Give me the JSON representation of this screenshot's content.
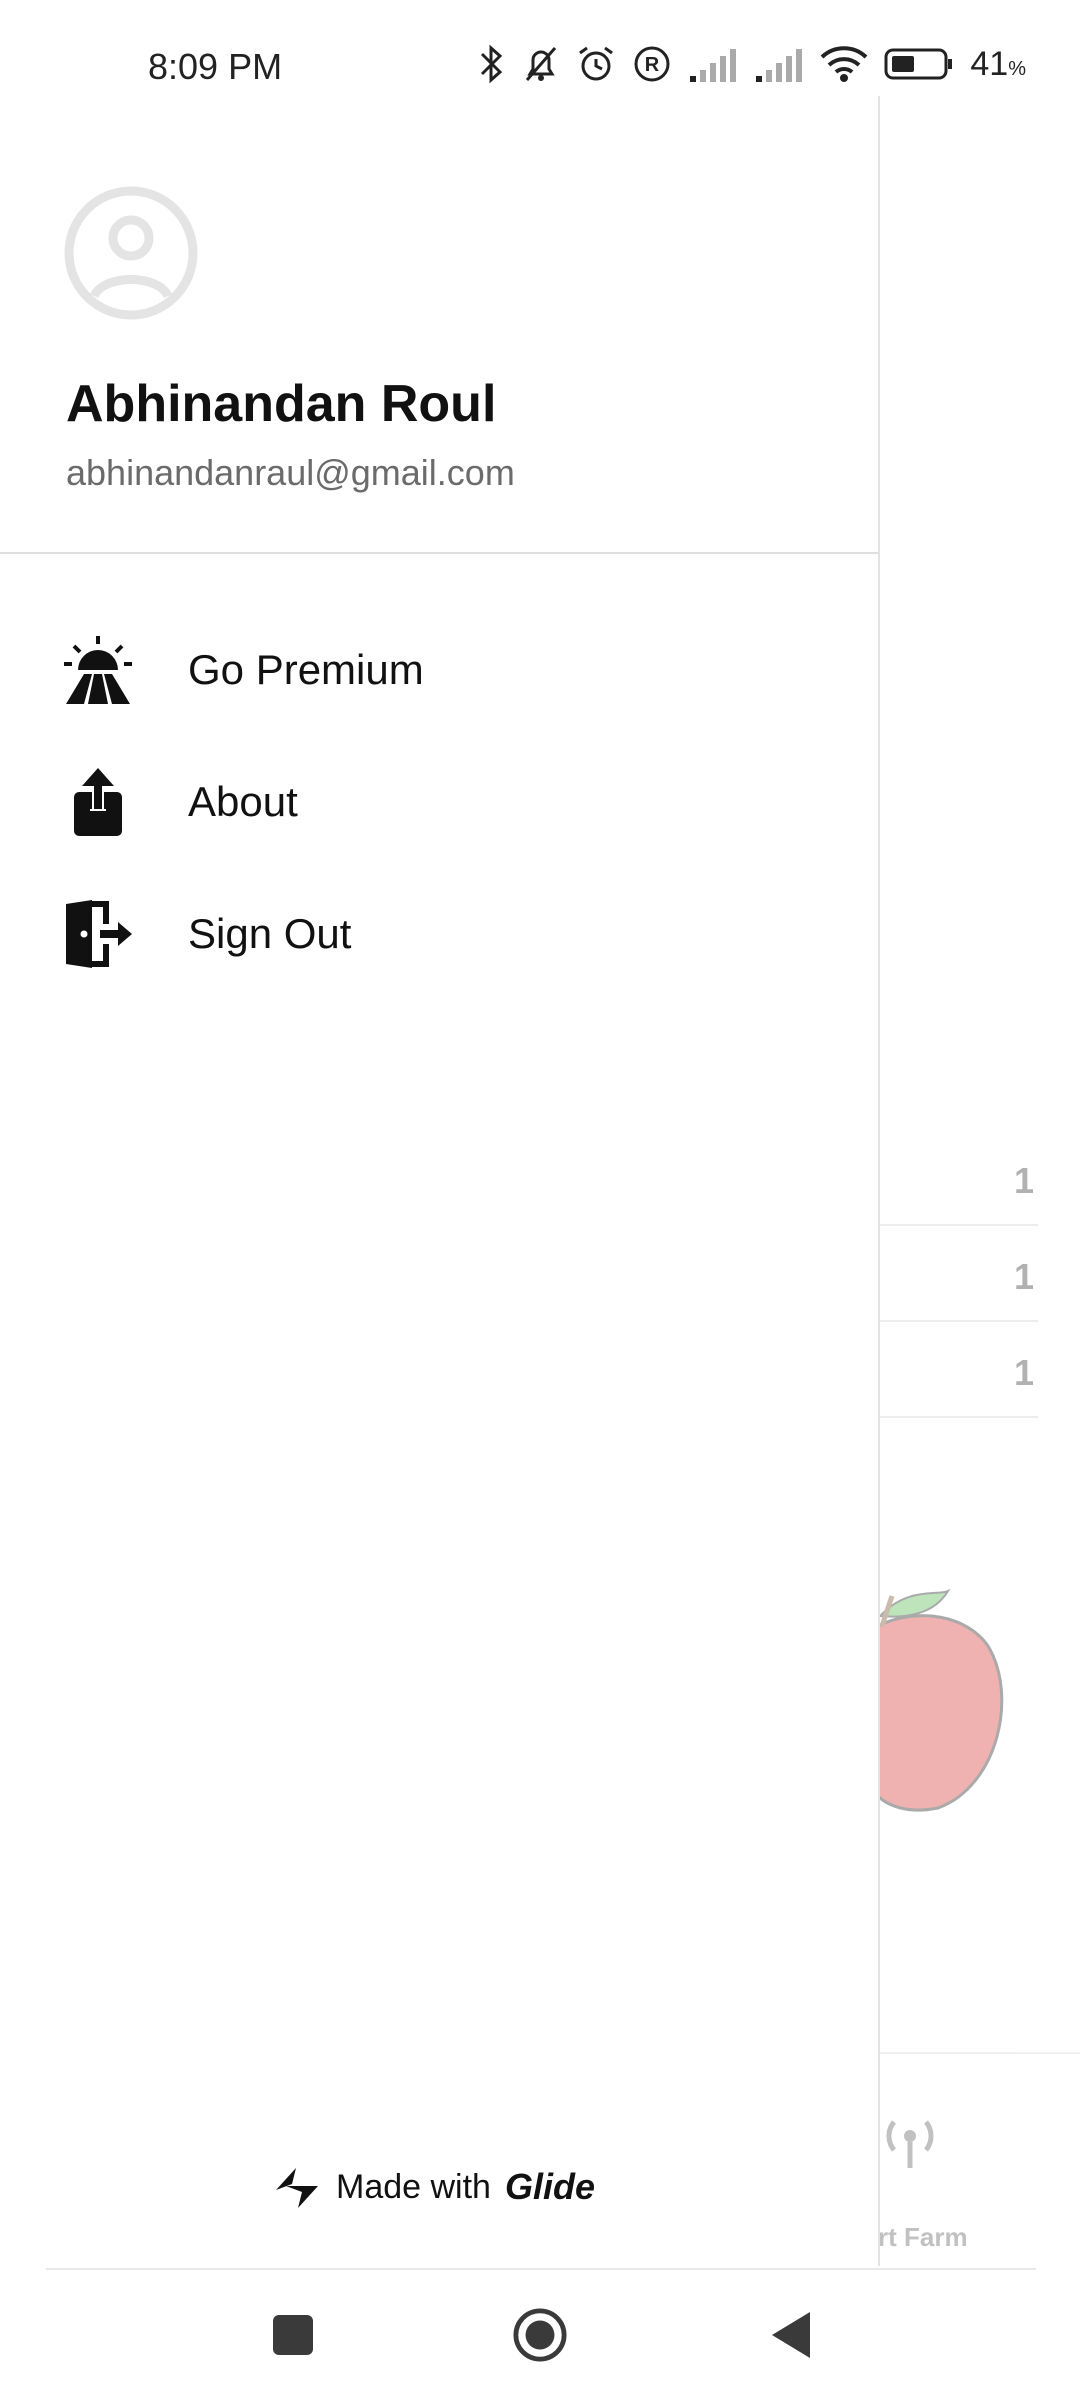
{
  "status_bar": {
    "time": "8:09 PM",
    "battery_percent": "41",
    "icons": [
      "bluetooth-icon",
      "bell-off-icon",
      "alarm-icon",
      "registered-icon",
      "signal-icon",
      "signal-icon",
      "wifi-icon",
      "battery-icon"
    ]
  },
  "drawer": {
    "user": {
      "name": "Abhinandan Roul",
      "email": "abhinandanraul@gmail.com"
    },
    "menu": [
      {
        "label": "Go Premium",
        "icon": "farm-sunrise-icon"
      },
      {
        "label": "About",
        "icon": "share-upload-icon"
      },
      {
        "label": "Sign Out",
        "icon": "exit-door-icon"
      }
    ],
    "footer": {
      "made_with": "Made with",
      "brand": "Glide"
    }
  },
  "background_app": {
    "row_values": [
      "1",
      "1",
      "1"
    ],
    "tab_label_partial": "rt Farm"
  },
  "colors": {
    "accent_text": "#111111",
    "secondary_text": "#6b6b6b",
    "divider": "#e0e0e0"
  }
}
